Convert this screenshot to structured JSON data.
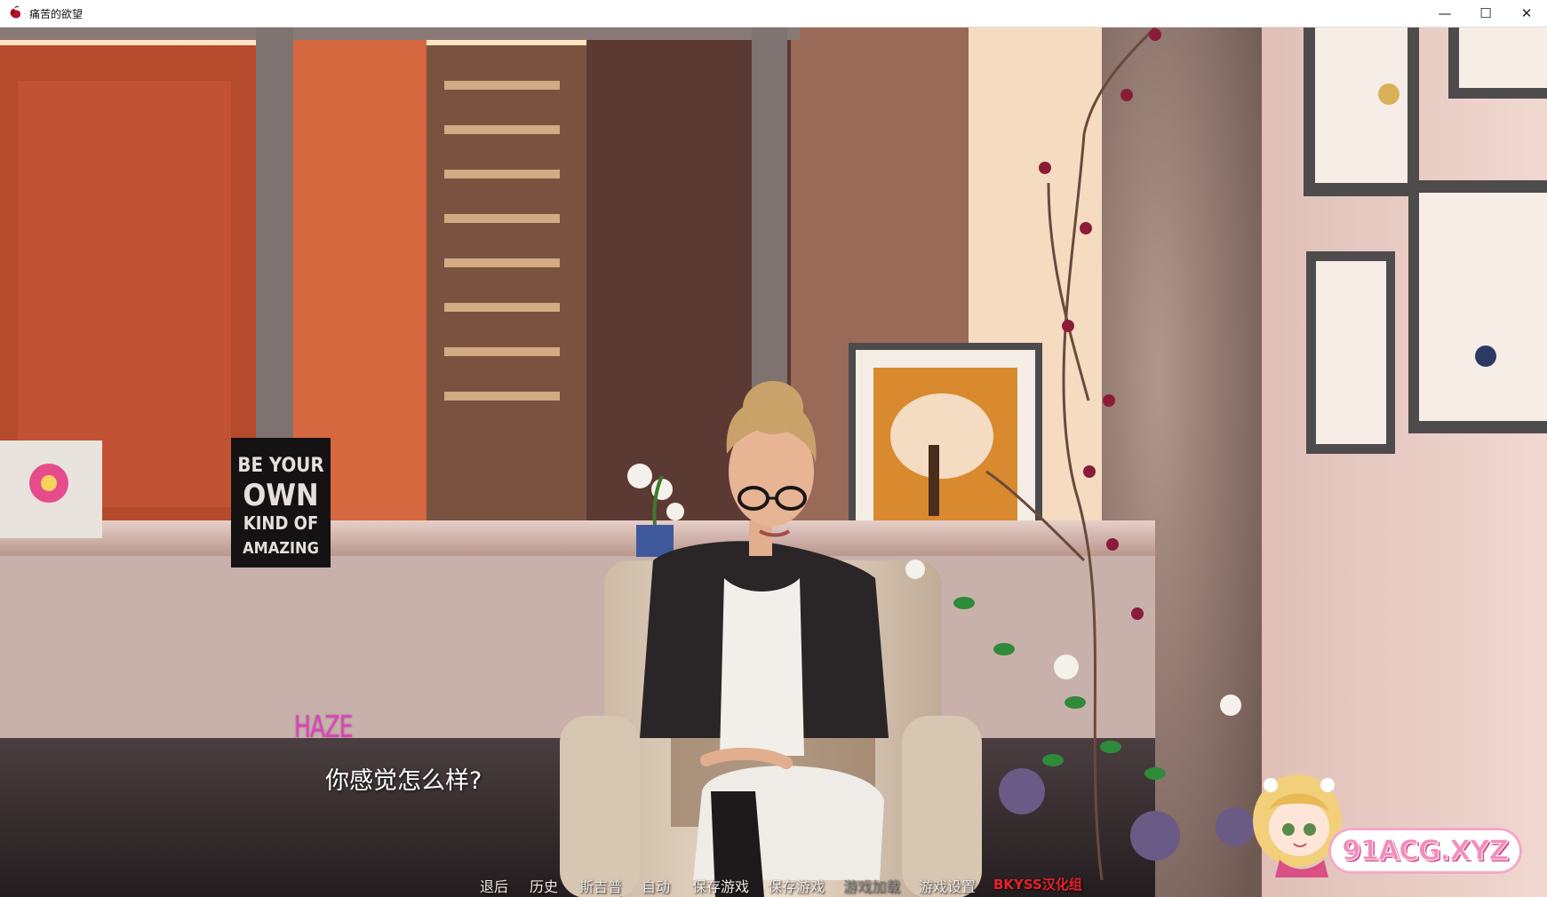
{
  "window": {
    "title": "痛苦的欲望",
    "controls": {
      "minimize": "—",
      "maximize": "☐",
      "close": "✕"
    }
  },
  "scene": {
    "sign_lines": [
      "BE YOUR",
      "OWN",
      "KIND OF",
      "AMAZING"
    ]
  },
  "dialogue": {
    "speaker": "HAZE",
    "speaker_color": "#e040c0",
    "text": "你感觉怎么样?"
  },
  "quick_menu": {
    "items": [
      {
        "label": "退后",
        "enabled": true
      },
      {
        "label": "历史",
        "enabled": true
      },
      {
        "label": "斯吉普",
        "enabled": true
      },
      {
        "label": "自动",
        "enabled": true
      },
      {
        "label": "保存游戏",
        "enabled": true
      },
      {
        "label": "保存游戏",
        "enabled": true
      },
      {
        "label": "游戏加载",
        "enabled": false
      },
      {
        "label": "游戏设置",
        "enabled": true
      }
    ],
    "credit": "BKYSS汉化组"
  },
  "watermark": {
    "text": "91ACG.XYZ"
  }
}
